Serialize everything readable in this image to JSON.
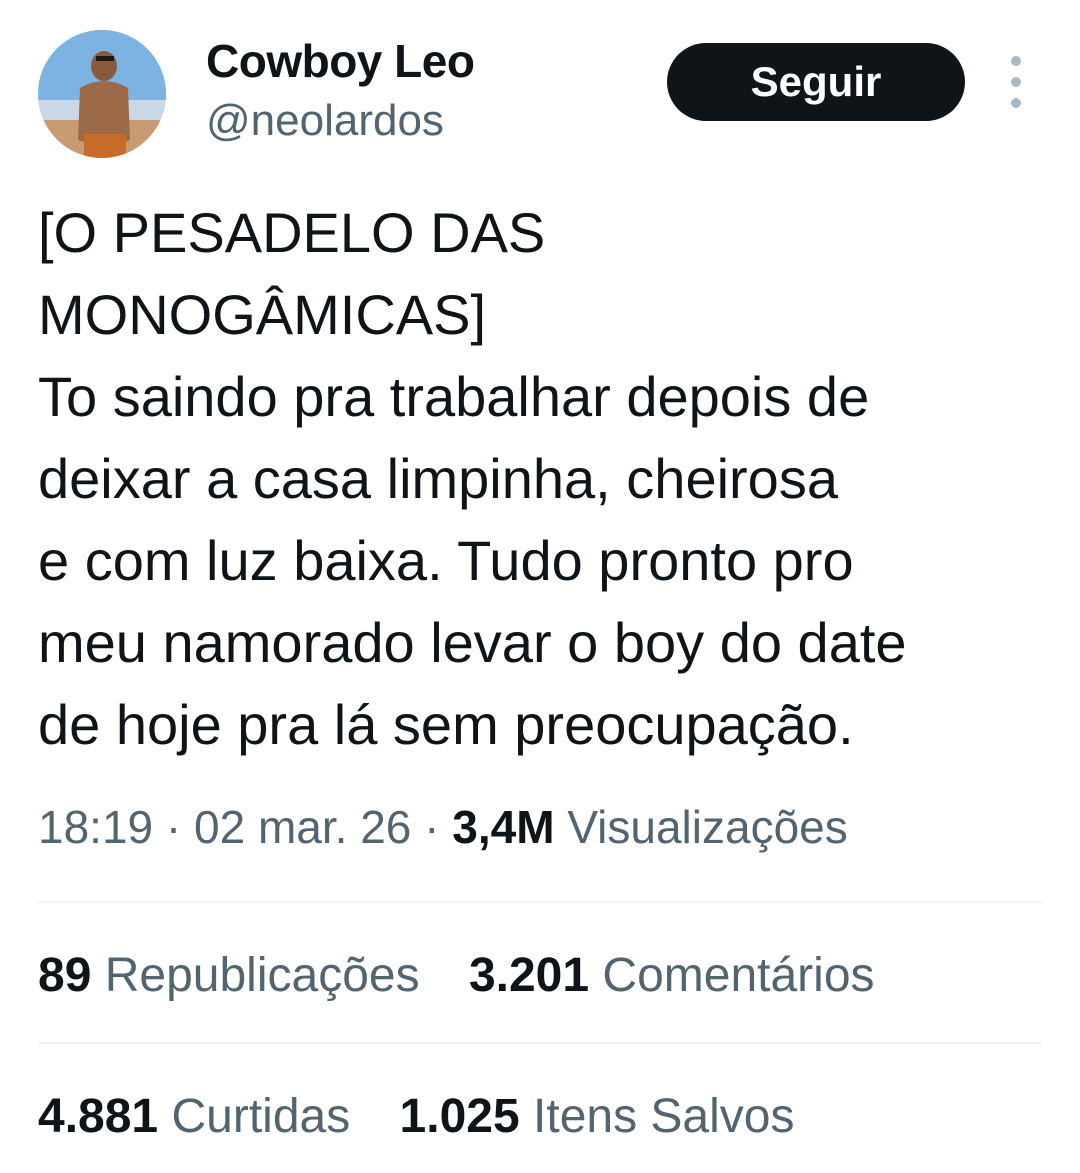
{
  "author": {
    "display_name": "Cowboy Leo",
    "handle": "@neolardos"
  },
  "actions": {
    "follow_label": "Seguir",
    "more_icon": "more-vertical-icon"
  },
  "tweet": {
    "lines": [
      "[O PESADELO DAS",
      "MONOGÂMICAS]",
      "To saindo pra trabalhar depois de",
      "deixar a casa limpinha, cheirosa",
      "e com luz baixa. Tudo pronto pro",
      "meu namorado levar o boy do date",
      "de hoje pra lá sem preocupação."
    ]
  },
  "meta": {
    "time": "18:19",
    "separator": "·",
    "date": "02 mar. 26",
    "views_count": "3,4M",
    "views_label": "Visualizações"
  },
  "stats": {
    "reposts_count": "89",
    "reposts_label": "Republicações",
    "comments_count": "3.201",
    "comments_label": "Comentários",
    "likes_count": "4.881",
    "likes_label": "Curtidas",
    "saves_count": "1.025",
    "saves_label": "Itens Salvos"
  },
  "colors": {
    "text_primary": "#0f1419",
    "text_secondary": "#536471",
    "button_bg": "#0f1419",
    "divider": "#eff3f4"
  }
}
